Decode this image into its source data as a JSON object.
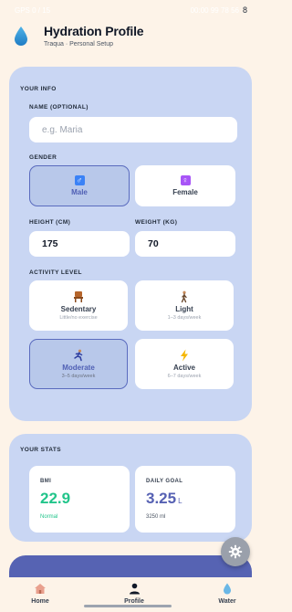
{
  "status_bar": {
    "left": "GPS 0 / 15",
    "right": "00:00 99 78 56",
    "tail": "8"
  },
  "header": {
    "title": "Hydration Profile",
    "subtitle": "Traqua · Personal Setup"
  },
  "your_info": {
    "section_title": "YOUR INFO",
    "name_label": "NAME (OPTIONAL)",
    "name_placeholder": "e.g. Maria",
    "gender_label": "GENDER",
    "gender_options": [
      {
        "label": "Male",
        "icon": "♂",
        "selected": true
      },
      {
        "label": "Female",
        "icon": "♀",
        "selected": false
      }
    ],
    "height_label": "HEIGHT (CM)",
    "height_value": "175",
    "weight_label": "WEIGHT (KG)",
    "weight_value": "70",
    "activity_label": "ACTIVITY LEVEL",
    "activity_options": [
      {
        "label": "Sedentary",
        "desc": "Little/no exercise",
        "icon": "chair-icon",
        "selected": false
      },
      {
        "label": "Light",
        "desc": "1–3 days/week",
        "icon": "walking-icon",
        "selected": false
      },
      {
        "label": "Moderate",
        "desc": "3–5 days/week",
        "icon": "running-icon",
        "selected": true
      },
      {
        "label": "Active",
        "desc": "6–7 days/week",
        "icon": "lightning-icon",
        "selected": false
      }
    ]
  },
  "your_stats": {
    "section_title": "YOUR STATS",
    "bmi": {
      "label": "BMI",
      "value": "22.9",
      "note": "Normal"
    },
    "daily_goal": {
      "label": "DAILY GOAL",
      "value": "3.25",
      "unit": "L",
      "note": "3250 ml"
    }
  },
  "nav": {
    "items": [
      {
        "label": "Home",
        "icon": "home-icon"
      },
      {
        "label": "Profile",
        "icon": "person-icon",
        "active": true
      },
      {
        "label": "Water",
        "icon": "water-drop-icon"
      }
    ]
  },
  "colors": {
    "background": "#fdf3e8",
    "card": "#c9d6f3",
    "accent": "#5661b3",
    "bmi_green": "#22c58b"
  }
}
